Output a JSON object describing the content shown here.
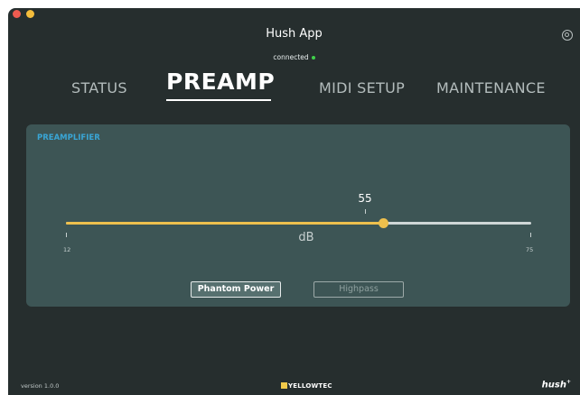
{
  "app": {
    "title": "Hush App",
    "connection_status": "connected",
    "connection_color": "#3fd14a"
  },
  "tabs": [
    {
      "label": "STATUS"
    },
    {
      "label": "PREAMP",
      "active": true
    },
    {
      "label": "MIDI SETUP"
    },
    {
      "label": "MAINTENANCE"
    }
  ],
  "icons": {
    "settings": "settings-ring-icon"
  },
  "preamp": {
    "section_title": "PREAMPLIFIER",
    "slider": {
      "value": "55",
      "min": "12",
      "max": "75",
      "unit": "dB"
    },
    "buttons": {
      "phantom_power": "Phantom Power",
      "highpass": "Highpass"
    },
    "accent_color": "#eec04d"
  },
  "footer": {
    "version": "version 1.0.0",
    "brand": "YELLOWTEC",
    "product": "hush",
    "product_sup": "+"
  }
}
